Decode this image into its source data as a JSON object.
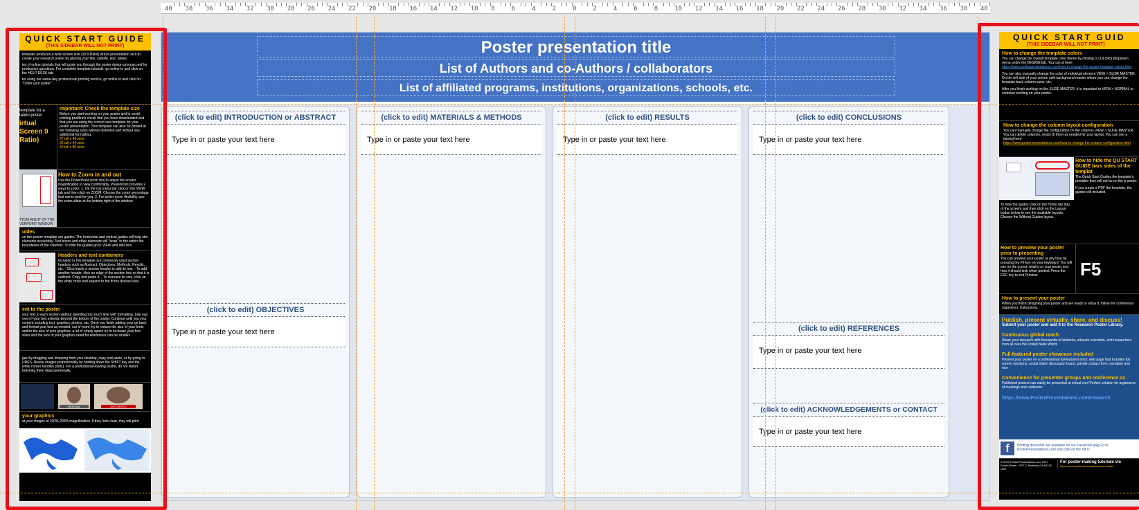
{
  "ruler": {
    "labels": [
      "40",
      "38",
      "36",
      "34",
      "32",
      "30",
      "28",
      "26",
      "24",
      "22",
      "20",
      "18",
      "16",
      "14",
      "12",
      "10",
      "8",
      "6",
      "4",
      "2",
      "0",
      "2",
      "4",
      "6",
      "8",
      "10",
      "12",
      "14",
      "16",
      "18",
      "20",
      "22",
      "24",
      "26",
      "28",
      "30",
      "32",
      "34",
      "36",
      "38",
      "40"
    ]
  },
  "poster": {
    "title": "Poster presentation title",
    "authors": "List of Authors and co-Authors / collaborators",
    "affiliations": "List of affiliated programs, institutions, organizations, schools, etc.",
    "placeholder": "Type in or paste your text here",
    "sections": {
      "introduction": "(click to edit) INTRODUCTION or ABSTRACT",
      "objectives": "(click to edit)  OBJECTIVES",
      "methods": "(click to edit)  MATERIALS & METHODS",
      "results": "(click to edit)  RESULTS",
      "conclusions": "(click to edit)  CONCLUSIONS",
      "references": "(click to edit)  REFERENCES",
      "acknowledgements": "(click to edit)  ACKNOWLEDGEMENTS or  CONTACT"
    }
  },
  "left_sidebar": {
    "title": "QUICK START GUIDE",
    "subtitle": "(THIS SIDEBAR WILL NOT PRINT)",
    "intro": "template produces a wide screen size (16:9 Ratio) virtual presentation se it to create your research poster by placing your title, subtitle, text, tables,",
    "tutorials": "ies of online tutorials that will guide you through the poster design process and for production questions. For complete template tutorials, go online to and click on the HELP DESK tab.",
    "printing": "ter using our same-day professional printing service, go online to and click on \"Order your poster\".",
    "template_for": "template for a tation poster",
    "virtual_screen": "irtual Screen 9 Ratio)",
    "check_size_h": "Important: Check the template size",
    "check_size_text": "Before you start working on your poster and to avoid printing problems check that you have downloaded and that you are using the correct size template for your poster presentation. This template can also be printed at the following sizes without distortion and without any additional formatting:",
    "sizes": [
      "27 tall x 48 wide",
      "36 tall x 64 wide",
      "45 tall x 80 wide"
    ],
    "zoom_h": "How to Zoom in and out",
    "zoom_text": "Use the PowerPoint zoom tool to adjust the screen magnification to view comfortably. PowerPoint provides 2 ways to zoom: 1. On the top menu bar click on the VIEW tab and then click on ZOOM. Choose the zoom percentage that works best for you. 2. For better zoom flexibility, use the zoom slider at the bottom right of the window.",
    "zoom_caption": "TTOM RIGHT OF THE VERPOINT WINDOW",
    "guides_h": "uides",
    "guides_text": "on this poster template are guides. The horizontal and vertical guides will help ster elements accurately. Text boxes and other elements will \"snap\" to the within the boundaries of the columns. To hide the guides go to VIEW and ides box.",
    "headers_h": "Headers and text containers",
    "headers_text": "Included in this template are commonly used section headers such as Abstract, Objectives, Methods, Results, etc. - Click inside a section header to add its text. - To add another header, click on edge of the section box so that it is outlined. Copy and paste it. - To increase its size, click on the white circle and expand to the fit the desired size.",
    "content_h": "ent to the poster",
    "content_text": "your text to each section without spending too much time with formatting. Like eas even if your text extends beyond the bottom of the poster. Continue until you your content including text, graphics, photos, etc. Once you finish adding your go back and format your text as needed. out of room, try to reduce the size of your fonts and/or the size of your graphics. a lot of empty space try to increase your font sizes and the size of your graphics need for references can be smaller.",
    "images_text": "ges by dragging and dropping from your desktop, copy and paste, or by going to URES. Resize images proportionally by holding down the SHIFT key and the white corner handles (dots). For a professional-looking poster, do not distort tretching them disproportionally.",
    "original_label": "ORIGINAL",
    "distorted_label": "DISTORTED",
    "graphics_h": "your graphics",
    "graphics_text": "at your images at 100%-200% magnification. If they look clear, they will print"
  },
  "right_sidebar": {
    "title": "QUICK START GUID",
    "subtitle": "(THIS SIDEBAR WILL NOT PRINT)",
    "colors_h": "How to change the template colors",
    "colors_text": "You can change the overall template color theme by clicking o COLORS dropdown menu under the DESIGN tab. You can al here:",
    "colors_link": "https://www.posterpresentations.com/how-to-change-the-poster-template-colors.html",
    "colors_text2": "You can also manually change the color of individual element VIEW > SLIDE MASTER. On the left side of your screen sele background master where you can change the template back column sizes, etc.",
    "colors_text3": "After you finish working on the SLIDE MASTER, it is important to VIEW > NORMAL to continue working on your poster.",
    "columns_h": "How to change the column layout configuration",
    "columns_text": "You can manually change the configuration on the columns VIEW > SLIDE MASTER. You can delete columns, resize th them as needed for your layout. You can see a tutorial here:",
    "columns_link": "https://www.posterpresentations.com/how-to-change-the-column-configuration.html",
    "hide_h": "How to hide the QU START GUIDE bars sides of the templat",
    "hide_text": "The Quick Start Guides the template's printable they will not be on the p poster.",
    "hide_text2": "If you create a PDF the template, the guides will included.",
    "guides_text": "To hide the guides click on the Home tab (top of the screen) and then click on the Layout button below to see the available layouts. Choose the Without Guides layout.",
    "preview_h": "How to preview your poster prior to presenting",
    "preview_text": "You can preview your poster at any time by pressing the F5 key on your keyboard. You will see on the screen what's on your poster and how it should look when printed. Press the ESC key to exit Preview.",
    "f5": "F5",
    "present_h": "How to present your poster",
    "present_text": "When you finish designing your poster and are ready to virtua it, follow the conference organizers' instructions.",
    "publish_h": "Publish, present virtually, share, and discuss!",
    "publish_text": "Submit your poster and add it to the Research Poster Library.",
    "reach_h": "Continuous global reach",
    "reach_text": "Share your research with thousands of students, educato scientists, and researchers from all over the United State World.",
    "showcase_h": "Full-featured poster showcase included",
    "showcase_text": "Present your poster on a professional full-featured and c web page that includes full screen functions, social sharin discussion board, private contact form, narration and mor",
    "convenience_h": "Convenience for presenter groups and conference co",
    "convenience_text": "Published posters can easily be presented at virtual conf Perfect solution for organizers of meetings and conferenc",
    "research_link": "https://www.PosterPresentations.com/research",
    "fb_text": "Printing discounts are available on our Facebook pag Go to PosterPresentations.com and click on the FB ic",
    "copyright": "© 2020 PosterPresentations.com 2117 Fourth Street · STE C Berkeley CA 94710 USA",
    "tutorials": "For poster-making tutorials vis",
    "tutorials_link": "https://www.posterpresentations.com/poster"
  },
  "colors": {
    "header_blue": "#4472c4",
    "guide_orange": "#f0a43a",
    "selection_red": "#e8101a",
    "sidebar_yellow": "#ffc000",
    "publish_blue": "#1f4e8c"
  }
}
